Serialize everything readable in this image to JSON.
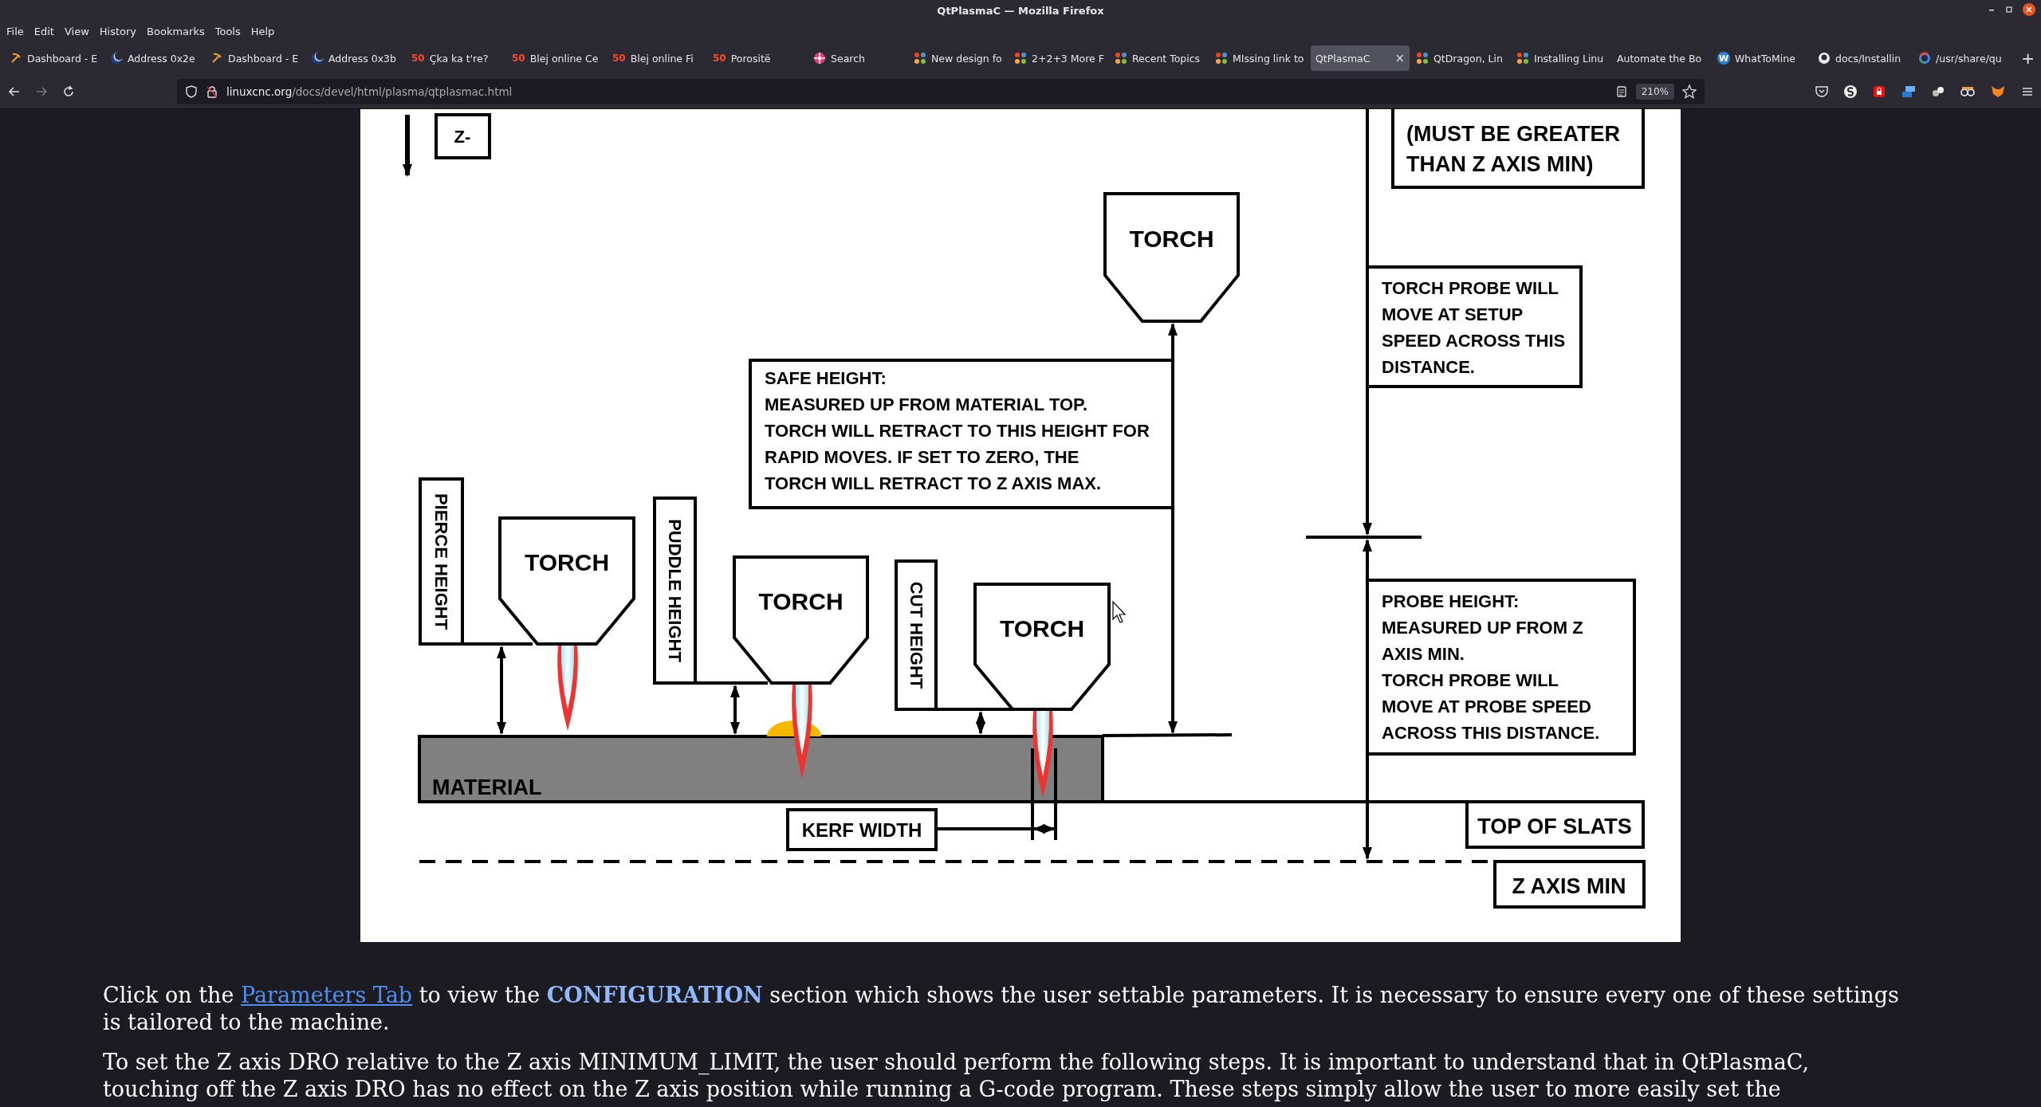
{
  "window": {
    "title": "QtPlasmaC — Mozilla Firefox"
  },
  "menu": [
    "File",
    "Edit",
    "View",
    "History",
    "Bookmarks",
    "Tools",
    "Help"
  ],
  "tabs": [
    {
      "label": "Dashboard - E",
      "kind": "pickaxe",
      "selected": false
    },
    {
      "label": "Address 0x2e",
      "kind": "moon",
      "selected": false
    },
    {
      "label": "Dashboard - E",
      "kind": "pickaxe",
      "selected": false
    },
    {
      "label": "Address 0x3b",
      "kind": "moon",
      "selected": false
    },
    {
      "label": "Çka ka t're?",
      "kind": "number",
      "icon_text": "50",
      "selected": false
    },
    {
      "label": "Blej online Ce",
      "kind": "number",
      "icon_text": "50",
      "selected": false
    },
    {
      "label": "Blej online Fi",
      "kind": "number",
      "icon_text": "50",
      "selected": false
    },
    {
      "label": "Porositë",
      "kind": "number",
      "icon_text": "50",
      "selected": false
    },
    {
      "label": "Search",
      "kind": "pinwheel",
      "selected": false
    },
    {
      "label": "New design fo",
      "kind": "joomla",
      "selected": false
    },
    {
      "label": "2+2+3 More F",
      "kind": "joomla",
      "selected": false
    },
    {
      "label": "Recent Topics",
      "kind": "joomla",
      "selected": false
    },
    {
      "label": "MIssing link to",
      "kind": "joomla",
      "selected": false
    },
    {
      "label": "QtPlasmaC",
      "kind": "plain",
      "selected": true,
      "close": "×"
    },
    {
      "label": "QtDragon, Lin",
      "kind": "joomla",
      "selected": false
    },
    {
      "label": "Installing Linu",
      "kind": "joomla",
      "selected": false
    },
    {
      "label": "Automate the Bo",
      "kind": "plain",
      "selected": false
    },
    {
      "label": "WhatToMine",
      "kind": "letter",
      "icon_text": "W",
      "selected": false
    },
    {
      "label": "docs/Installin",
      "kind": "github",
      "selected": false
    },
    {
      "label": "/usr/share/qu",
      "kind": "google",
      "selected": false
    }
  ],
  "new_tab": "+",
  "navigation": {
    "forward_disabled": true,
    "url": {
      "host": "linuxcnc.org",
      "path": "/docs/devel/html/plasma/qtplasmac.html"
    },
    "zoom": "210%"
  },
  "diagram": {
    "z_direction": "Z-",
    "z_axis_max_note": [
      "(MUST BE GREATER",
      "THAN Z AXIS MIN)"
    ],
    "torches": [
      "TORCH",
      "TORCH",
      "TORCH",
      "TORCH"
    ],
    "height_labels": [
      "PIERCE HEIGHT",
      "PUDDLE HEIGHT",
      "CUT HEIGHT"
    ],
    "safe_height_note": [
      "SAFE HEIGHT:",
      "MEASURED UP FROM MATERIAL TOP.",
      "TORCH WILL RETRACT TO THIS HEIGHT FOR",
      "RAPID MOVES.  IF SET TO ZERO, THE",
      "TORCH WILL RETRACT TO Z AXIS MAX."
    ],
    "setup_speed_note": [
      "TORCH PROBE WILL",
      "MOVE AT SETUP",
      "SPEED ACROSS THIS",
      "DISTANCE."
    ],
    "probe_height_note": [
      "PROBE HEIGHT:",
      "MEASURED UP FROM Z",
      "AXIS MIN.",
      "TORCH PROBE WILL",
      "MOVE AT PROBE SPEED",
      "ACROSS THIS DISTANCE."
    ],
    "material": "MATERIAL",
    "kerf_width": "KERF WIDTH",
    "top_of_slats": "TOP OF SLATS",
    "z_axis_min": "Z AXIS MIN"
  },
  "paragraphs": [
    [
      {
        "kind": "text",
        "text": "Click on the "
      },
      {
        "kind": "link",
        "text": "Parameters Tab"
      },
      {
        "kind": "text",
        "text": " to view the **CONFIGURATION** section which shows the user settable parameters. It is necessary to ensure every one of these settings is tailored to the machine."
      }
    ],
    [
      {
        "kind": "text",
        "text": "To set the Z axis DRO relative to the Z axis MINIMUM_LIMIT, the user should perform the following steps. It is important to understand that in QtPlasmaC, touching off the Z axis DRO has no effect on the Z axis position while running a G-code program. These steps simply allow the user to more easily set the"
      }
    ]
  ]
}
